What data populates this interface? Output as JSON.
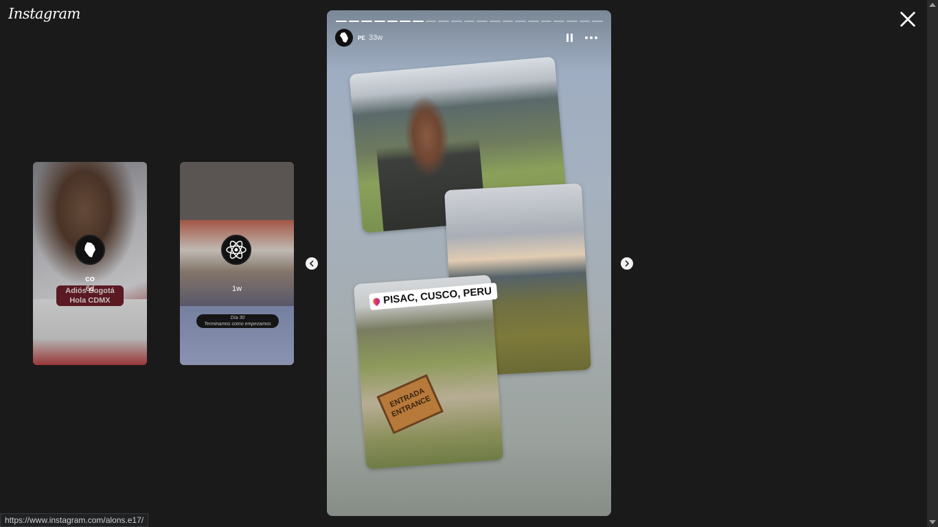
{
  "app": {
    "logo_text": "Instagram"
  },
  "previews": [
    {
      "username": "co",
      "time": "6d",
      "caption_line1": "Adiós Bogotá",
      "caption_line2": "Hola CDMX"
    },
    {
      "username": "",
      "time": "1w",
      "caption_line1": "Día 30",
      "caption_line2": "Terminamos como empezamos"
    }
  ],
  "story": {
    "username": "PE",
    "time": "33w",
    "progress": {
      "total": 21,
      "completed": 7
    },
    "location": "PISAC, CUSCO, PERU",
    "sign_line1": "ENTRADA",
    "sign_line2": "ENTRANCE"
  },
  "status_bar": {
    "url": "https://www.instagram.com/alons.e17/"
  },
  "icons": {
    "close": "close-icon",
    "prev": "chevron-left-icon",
    "next": "chevron-right-icon",
    "pause": "pause-icon",
    "more": "more-horizontal-icon"
  }
}
